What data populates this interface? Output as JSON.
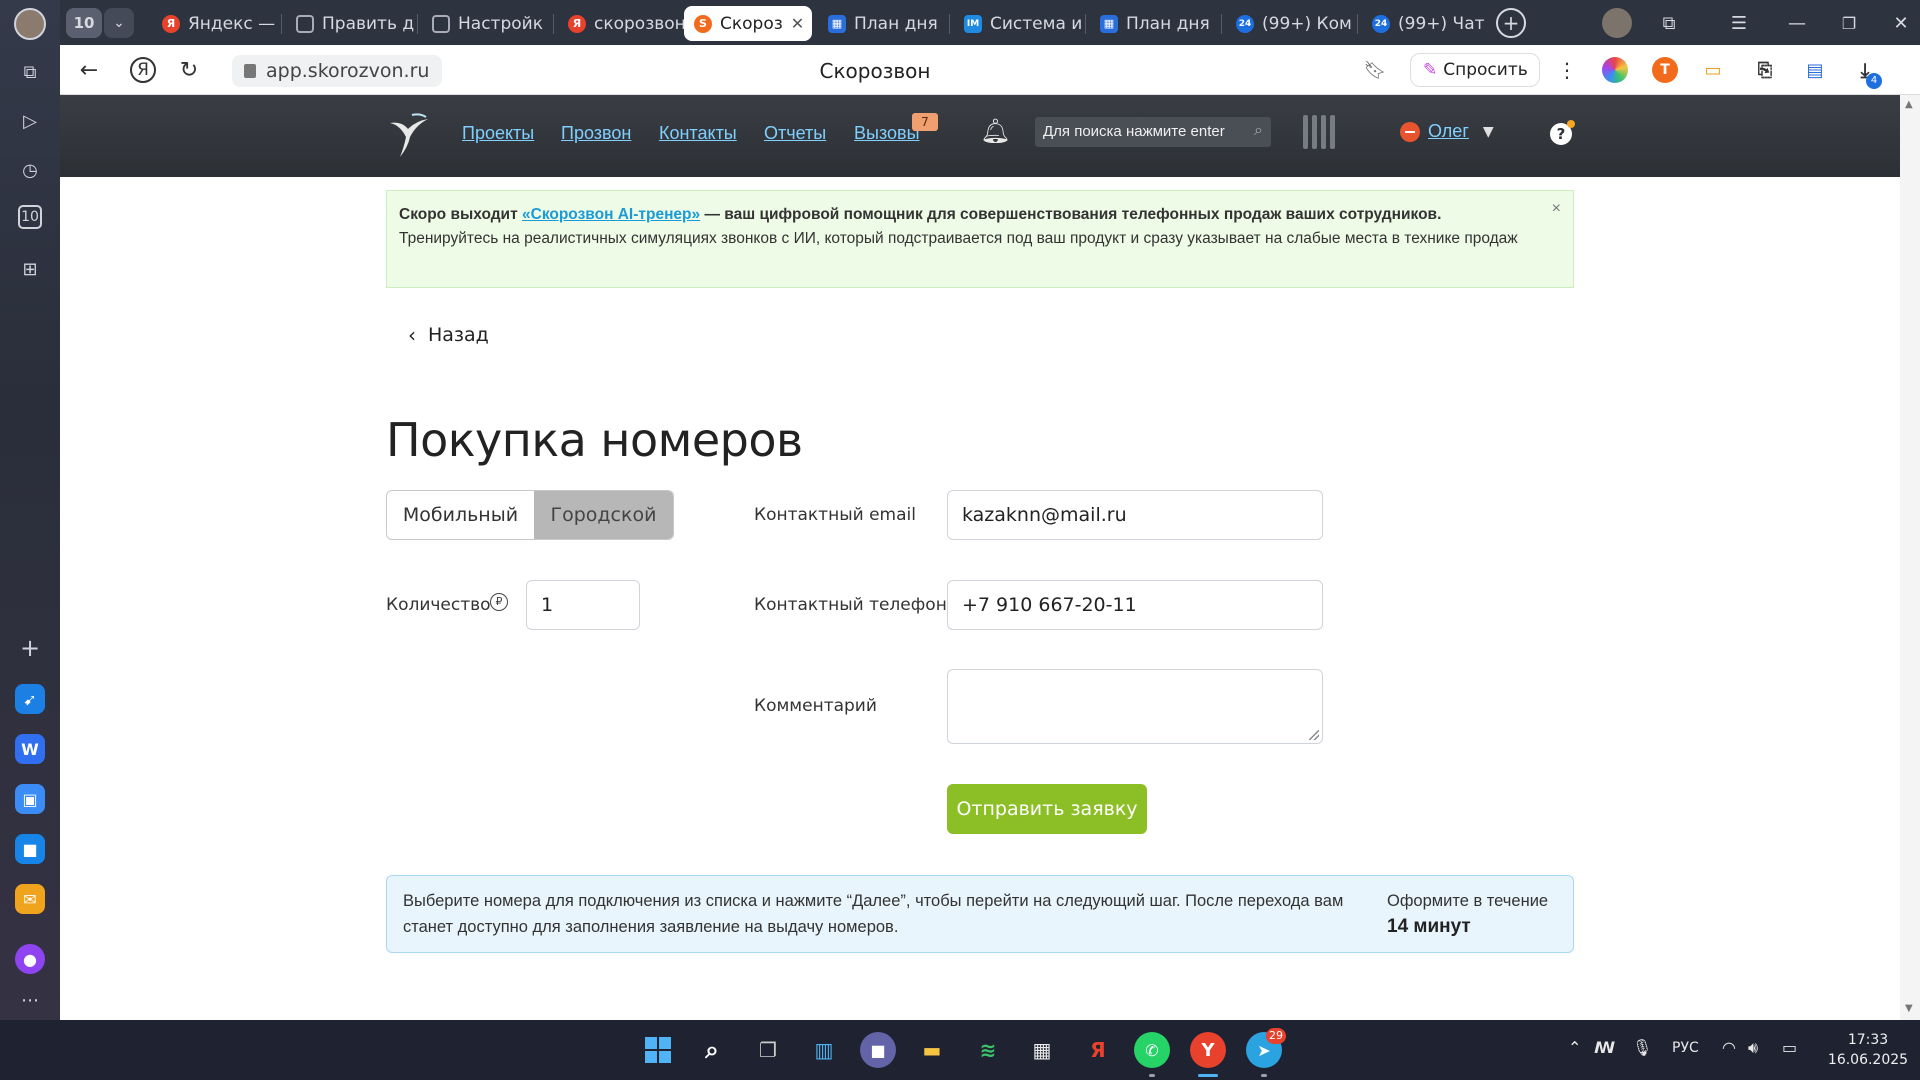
{
  "browser": {
    "tab_count": "10",
    "tabs": [
      {
        "label": "Яндекс —",
        "fav": "Я",
        "fav_color": "#e8412c"
      },
      {
        "label": "Править д",
        "fav": "",
        "fav_color": "#8a8f99"
      },
      {
        "label": "Настройк",
        "fav": "",
        "fav_color": "#8a8f99"
      },
      {
        "label": "скорозвон",
        "fav": "Я",
        "fav_color": "#e8412c"
      },
      {
        "label": "Скороз",
        "fav": "S",
        "fav_color": "#f26b1d"
      },
      {
        "label": "План дня",
        "fav": "▦",
        "fav_color": "#2a6edb"
      },
      {
        "label": "Система и",
        "fav": "IM",
        "fav_color": "#1f8ae0"
      },
      {
        "label": "План дня",
        "fav": "▦",
        "fav_color": "#2a6edb"
      },
      {
        "label": "(99+) Ком",
        "fav": "24",
        "fav_color": "#1d6fe0"
      },
      {
        "label": "(99+) Чат",
        "fav": "24",
        "fav_color": "#1d6fe0"
      }
    ],
    "url": "app.skorozvon.ru",
    "page_title": "Скорозвон",
    "ask_label": "Спросить",
    "ext_badge": "4"
  },
  "app": {
    "menu": [
      "Проекты",
      "Прозвон",
      "Контакты",
      "Отчеты",
      "Вызовы"
    ],
    "calls_badge": "7",
    "search_placeholder": "Для поиска нажмите enter",
    "user_name": "Олег",
    "help": "?"
  },
  "promo": {
    "lead": "Скоро выходит ",
    "link": "«Скорозвон AI-тренер»",
    "rest": " — ваш цифровой помощник для совершенствования телефонных продаж ваших сотрудников.",
    "body": "Тренируйтесь на реалистичных симуляциях звонков с ИИ, который подстраивается под ваш продукт и сразу указывает на слабые места в технике продаж",
    "close": "×"
  },
  "form": {
    "back_label": "Назад",
    "title": "Покупка номеров",
    "type_options": [
      "Мобильный",
      "Городской"
    ],
    "type_selected": "Городской",
    "quantity_label": "Количество",
    "quantity_value": "1",
    "email_label": "Контактный email",
    "email_value": "kazaknn@mail.ru",
    "phone_label": "Контактный телефон",
    "phone_value": "+7 910 667-20-11",
    "comment_label": "Комментарий",
    "comment_value": "",
    "submit_label": "Отправить заявку"
  },
  "info": {
    "text": "Выберите номера для подключения из списка и нажмите “Далее”, чтобы перейти на следующий шаг. После перехода вам станет доступно для заполнения заявление на выдачу номеров.",
    "timer_label": "Оформите в течение",
    "timer_value": "14 минут"
  },
  "taskbar": {
    "telegram_badge": "29",
    "lang": "РУС",
    "time": "17:33",
    "date": "16.06.2025"
  }
}
